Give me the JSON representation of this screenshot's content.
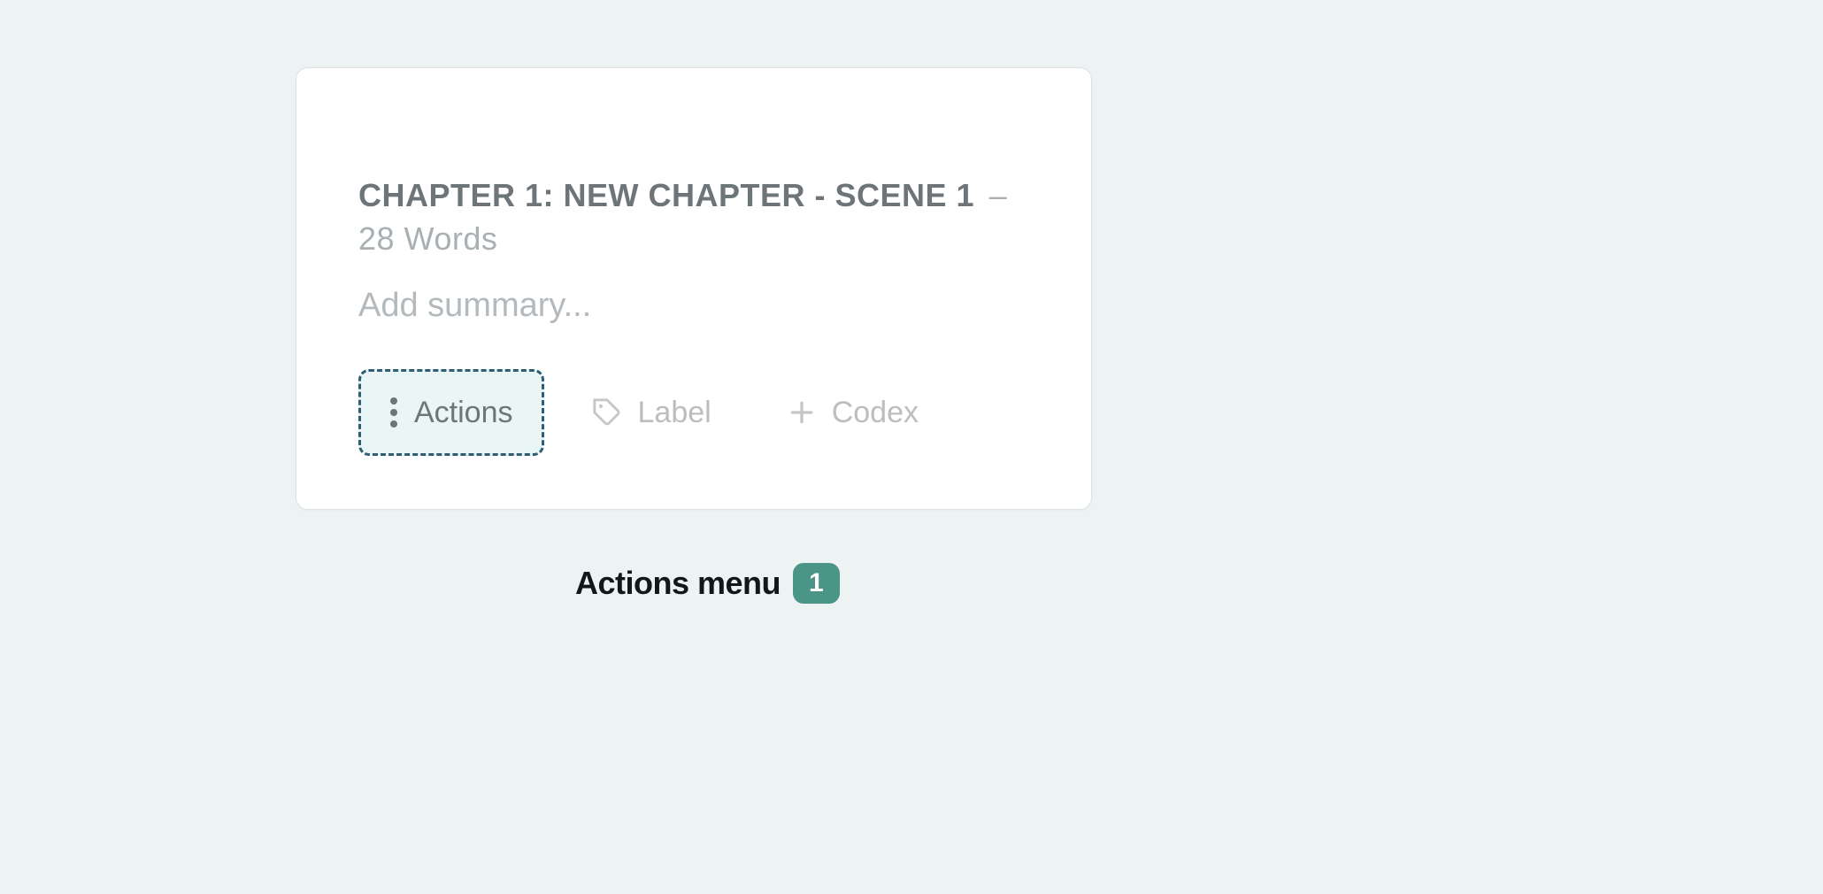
{
  "card": {
    "title": "CHAPTER 1: NEW CHAPTER - SCENE 1",
    "separator": "–",
    "word_count_text": "28 Words",
    "summary_placeholder": "Add summary...",
    "buttons": {
      "actions": "Actions",
      "label": "Label",
      "codex": "Codex"
    }
  },
  "caption": {
    "text": "Actions menu",
    "badge": "1"
  }
}
